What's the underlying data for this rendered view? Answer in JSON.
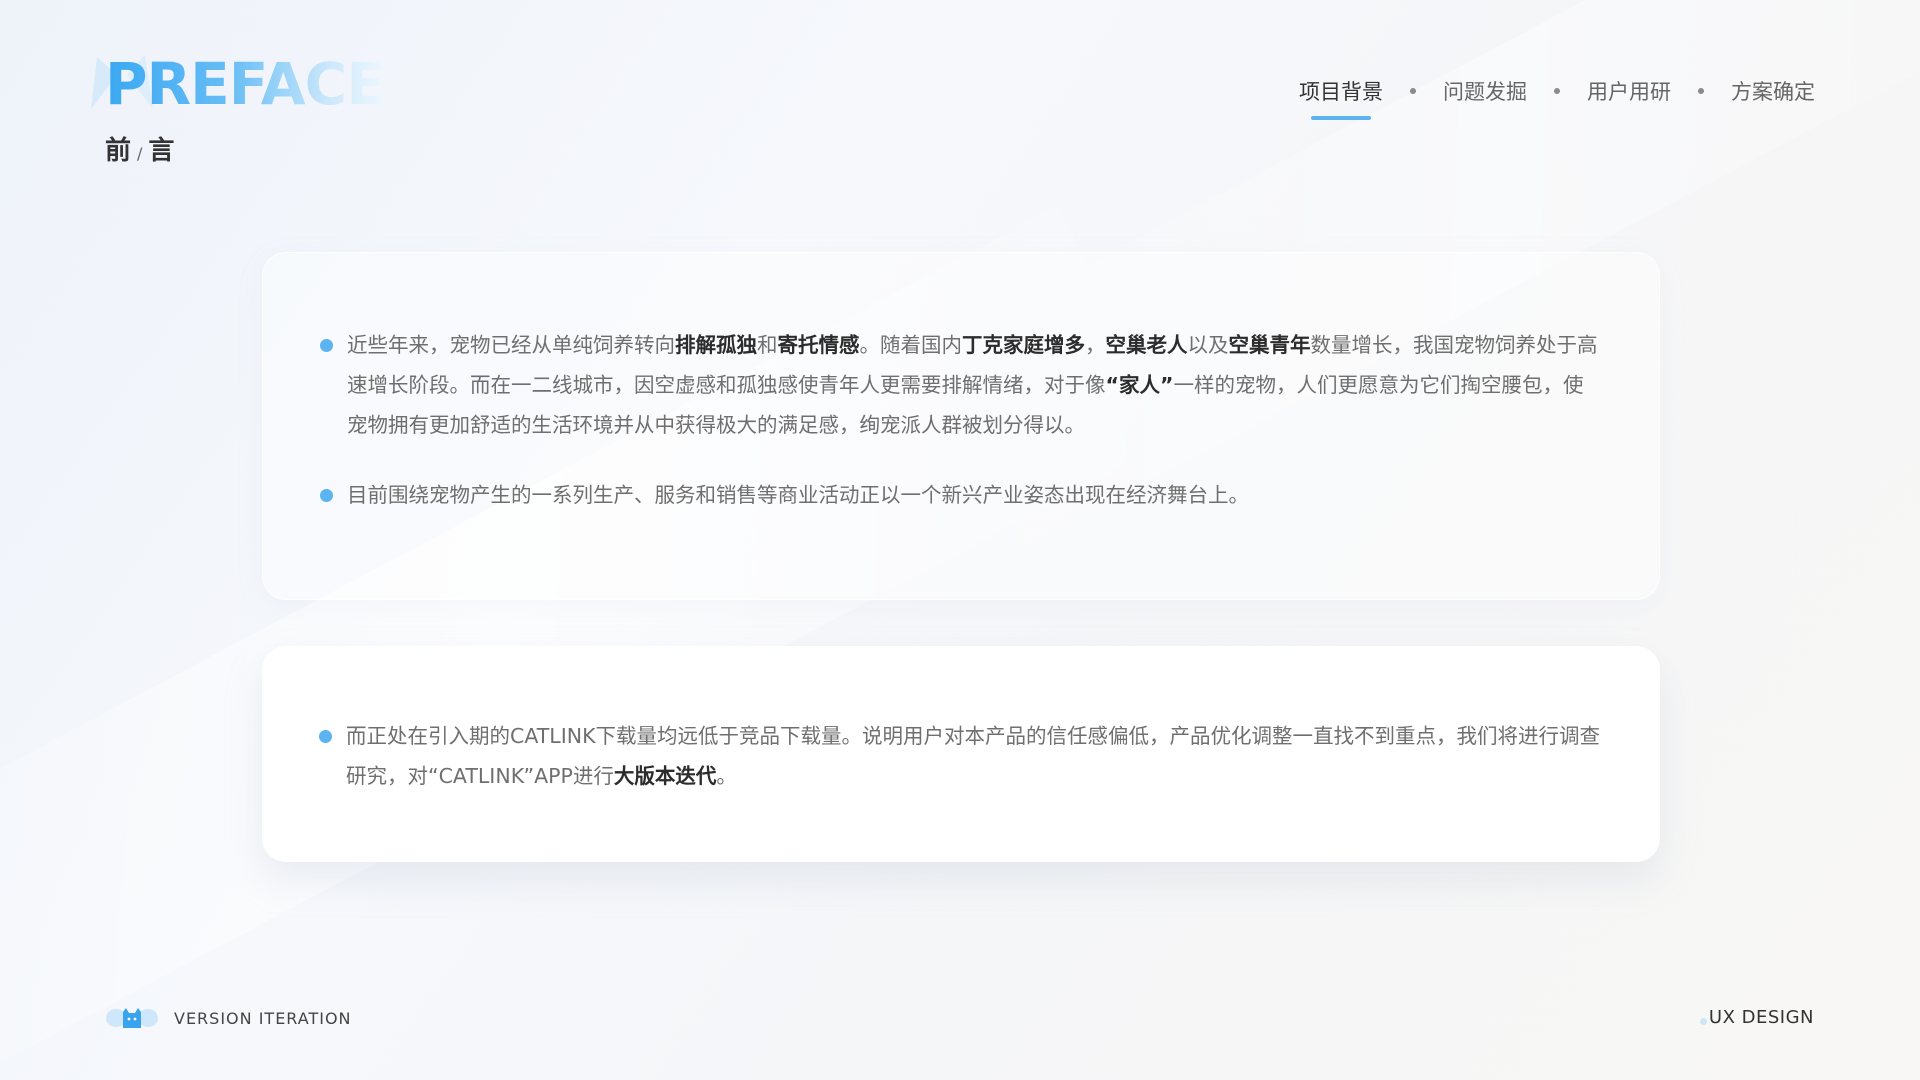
{
  "header": {
    "brand_title": "PREFACE",
    "brand_sub_left": "前",
    "brand_sub_sep": "/",
    "brand_sub_right": "言"
  },
  "nav": {
    "items": [
      {
        "label": "项目背景",
        "active": true
      },
      {
        "label": "问题发掘",
        "active": false
      },
      {
        "label": "用户用研",
        "active": false
      },
      {
        "label": "方案确定",
        "active": false
      }
    ]
  },
  "card1": {
    "p1": {
      "t1": "近些年来，宠物已经从单纯饲养转向",
      "b1": "排解孤独",
      "t2": "和",
      "b2": "寄托情感",
      "t3": "。随着国内",
      "b3": "丁克家庭增多",
      "t4": "，",
      "b4": "空巢老人",
      "t5": "以及",
      "b5": "空巢青年",
      "t6": "数量增长，我国宠物饲养处于高速增长阶段。而在一二线城市，因空虚感和孤独感使青年人更需要排解情绪，对于像",
      "b6": "“家人”",
      "t7": "一样的宠物，人们更愿意为它们掏空腰包，使宠物拥有更加舒适的生活环境并从中获得极大的满足感，绚宠派人群被划分得以。"
    },
    "p2": "目前围绕宠物产生的一系列生产、服务和销售等商业活动正以一个新兴产业姿态出现在经济舞台上。"
  },
  "card2": {
    "t1": "而正处在引入期的CATLINK下载量均远低于竞品下载量。说明用户对本产品的信任感偏低，产品优化调整一直找不到重点，我们将进行调查研究，对“CATLINK”APP进行",
    "b1": "大版本迭代",
    "t2": "。"
  },
  "footer": {
    "left_label": "VERSION ITERATION",
    "right_label": "UX DESIGN"
  },
  "colors": {
    "accent": "#5bb4ef",
    "text": "#6f6f6f",
    "strong": "#2c2c2c"
  }
}
